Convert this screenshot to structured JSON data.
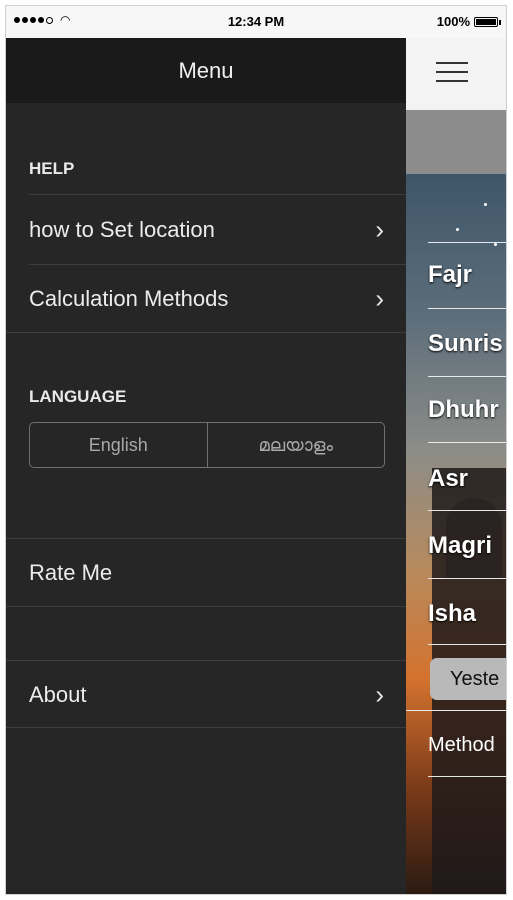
{
  "status_bar": {
    "time": "12:34 PM",
    "battery": "100%",
    "battery_level": 1.0
  },
  "menu": {
    "title": "Menu",
    "help_section": "HELP",
    "help_items": [
      {
        "label": "how to Set location"
      },
      {
        "label": "Calculation Methods"
      }
    ],
    "language_section": "LANGUAGE",
    "languages": [
      "English",
      "മലയാളം"
    ],
    "rate_label": "Rate Me",
    "about_label": "About"
  },
  "right_panel": {
    "prayers": [
      "Fajr",
      "Sunris",
      "Dhuhr",
      "Asr",
      "Magri",
      "Isha"
    ],
    "yesterday_button": "Yeste",
    "method_label": "Method"
  },
  "icons": {
    "menu": "hamburger-icon",
    "chevron": "chevron-right-icon",
    "wifi": "wifi-icon",
    "battery": "battery-icon"
  }
}
